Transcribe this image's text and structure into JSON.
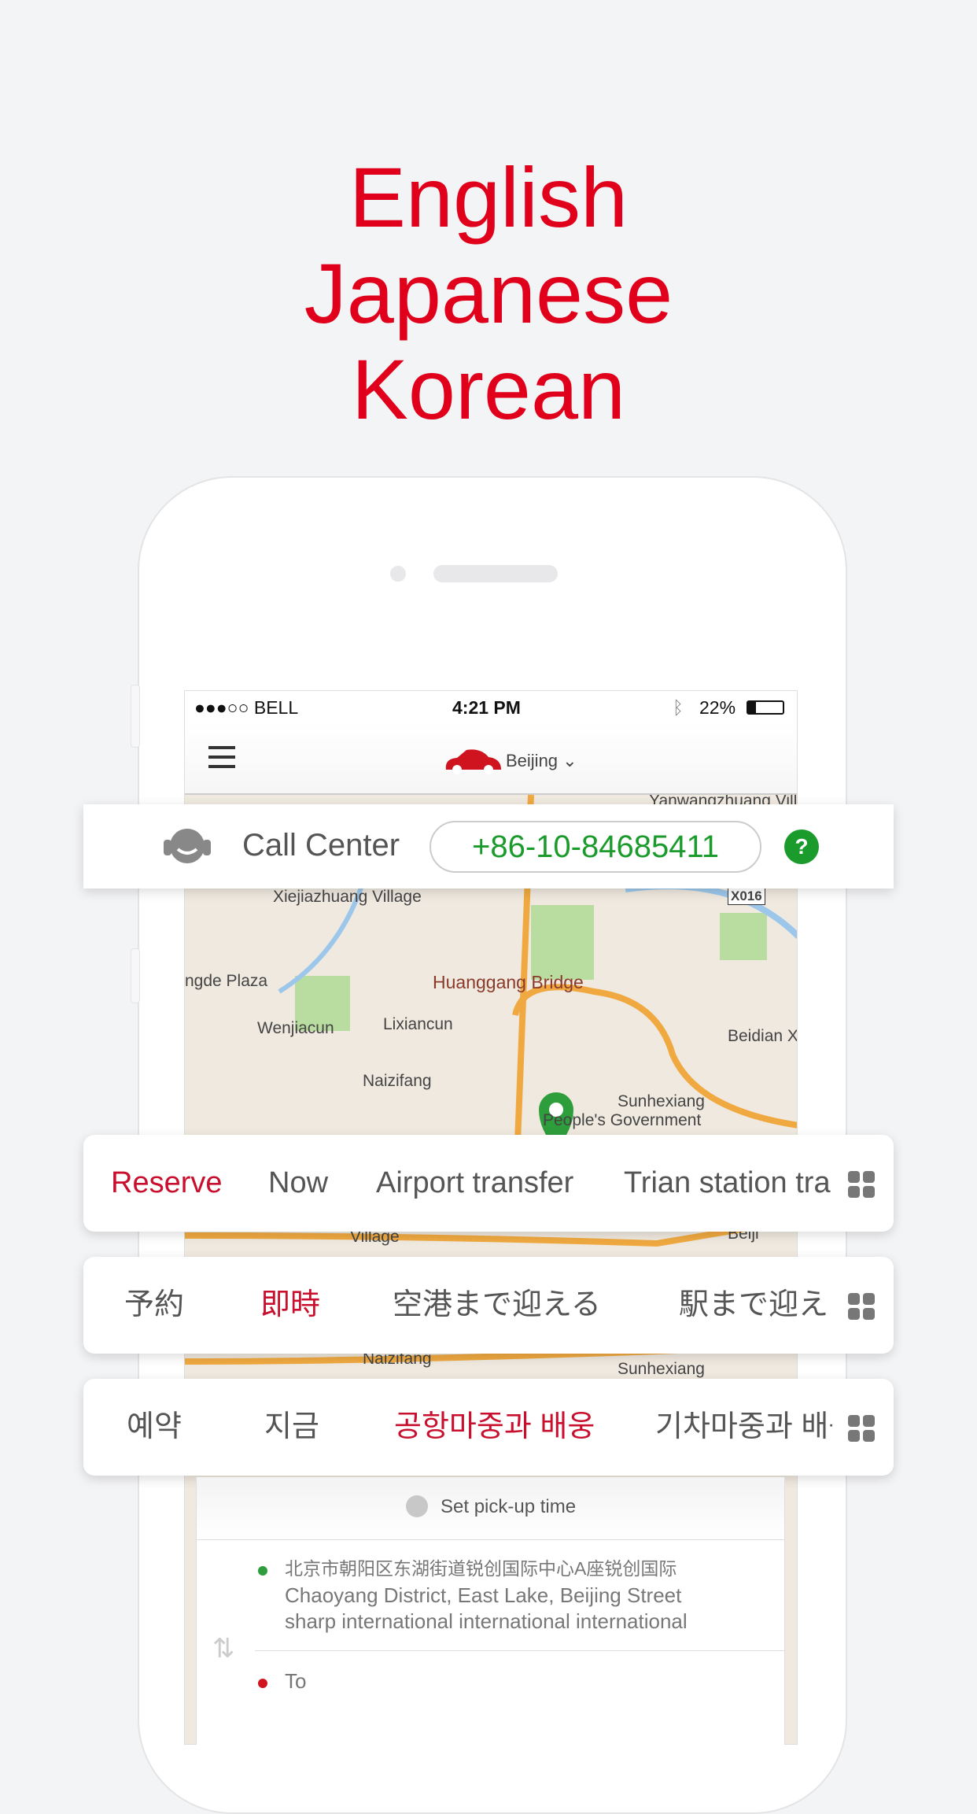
{
  "headline": [
    "English",
    "Japanese",
    "Korean"
  ],
  "status": {
    "carrier": "●●●○○ BELL",
    "time": "4:21 PM",
    "battery": "22%"
  },
  "nav": {
    "city": "Beijing",
    "menu_icon": "hamburger-icon",
    "car_icon": "car-icon"
  },
  "map_labels": [
    "Yanwangzhuang Vill",
    "Xiejiazhuang Village",
    "X016",
    "ngde Plaza",
    "Huanggang Bridge",
    "Wenjiacun",
    "Lixiancun",
    "Beidian X",
    "Naizifang",
    "Sunhexiang",
    "People's Government",
    "Village",
    "Beiji",
    "Naizifang",
    "Sunhexiang"
  ],
  "call_center": {
    "label": "Call Center",
    "phone": "+86-10-84685411",
    "help": "?"
  },
  "tab_bars": [
    {
      "tabs": [
        "Reserve",
        "Now",
        "Airport transfer",
        "Trian station tra"
      ],
      "active": 0
    },
    {
      "tabs": [
        "予約",
        "即時",
        "空港まで迎える",
        "駅まで迎え"
      ],
      "active": 1
    },
    {
      "tabs": [
        "예약",
        "지금",
        "공항마중과 배웅",
        "기차마중과 배웅"
      ],
      "active": 2
    }
  ],
  "booking": {
    "pickup_time": "Set pick-up time",
    "from_cn": "北京市朝阳区东湖街道锐创国际中心A座锐创国际",
    "from_en1": "Chaoyang District, East Lake, Beijing Street",
    "from_en2": "sharp international international international",
    "to": "To"
  },
  "colors": {
    "accent": "#e0001b",
    "active_tab": "#c8102e",
    "phone_green": "#1a9b2c"
  }
}
